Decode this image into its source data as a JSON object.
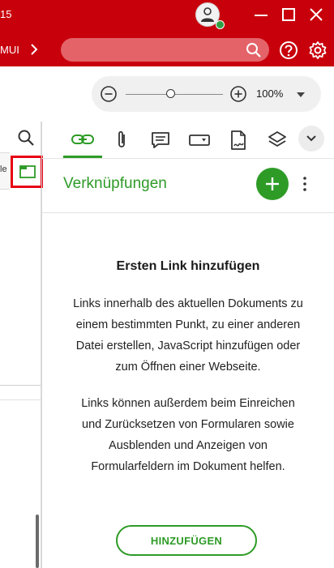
{
  "titlebar": {
    "number_fragment": "15"
  },
  "toolbar": {
    "left_text": "MUI"
  },
  "zoom": {
    "value": "100%",
    "slider_fraction": 0.46
  },
  "left_strip": {
    "doc_edge_text": "le"
  },
  "panel": {
    "tabs": [
      {
        "icon": "link-icon",
        "active": true
      },
      {
        "icon": "paperclip-icon"
      },
      {
        "icon": "comment-icon"
      },
      {
        "icon": "form-field-icon"
      },
      {
        "icon": "signature-document-icon"
      },
      {
        "icon": "layers-icon"
      }
    ],
    "title": "Verknüpfungen",
    "empty_state": {
      "heading": "Ersten Link hinzufügen",
      "para1_lines": [
        "Links innerhalb des aktuellen Dokuments zu",
        "einem bestimmten Punkt, zu einer anderen",
        "Datei erstellen, JavaScript hinzufügen oder",
        "zum Öffnen einer Webseite."
      ],
      "para2_lines": [
        "Links können außerdem beim Einreichen",
        "und Zurücksetzen von Formularen sowie",
        "Ausblenden und Anzeigen von",
        "Formularfeldern im Dokument helfen."
      ],
      "button_label": "HINZUFÜGEN"
    }
  },
  "colors": {
    "brand_red": "#c8000c",
    "accent_green": "#2e9b27",
    "highlight_red": "#e60012"
  }
}
